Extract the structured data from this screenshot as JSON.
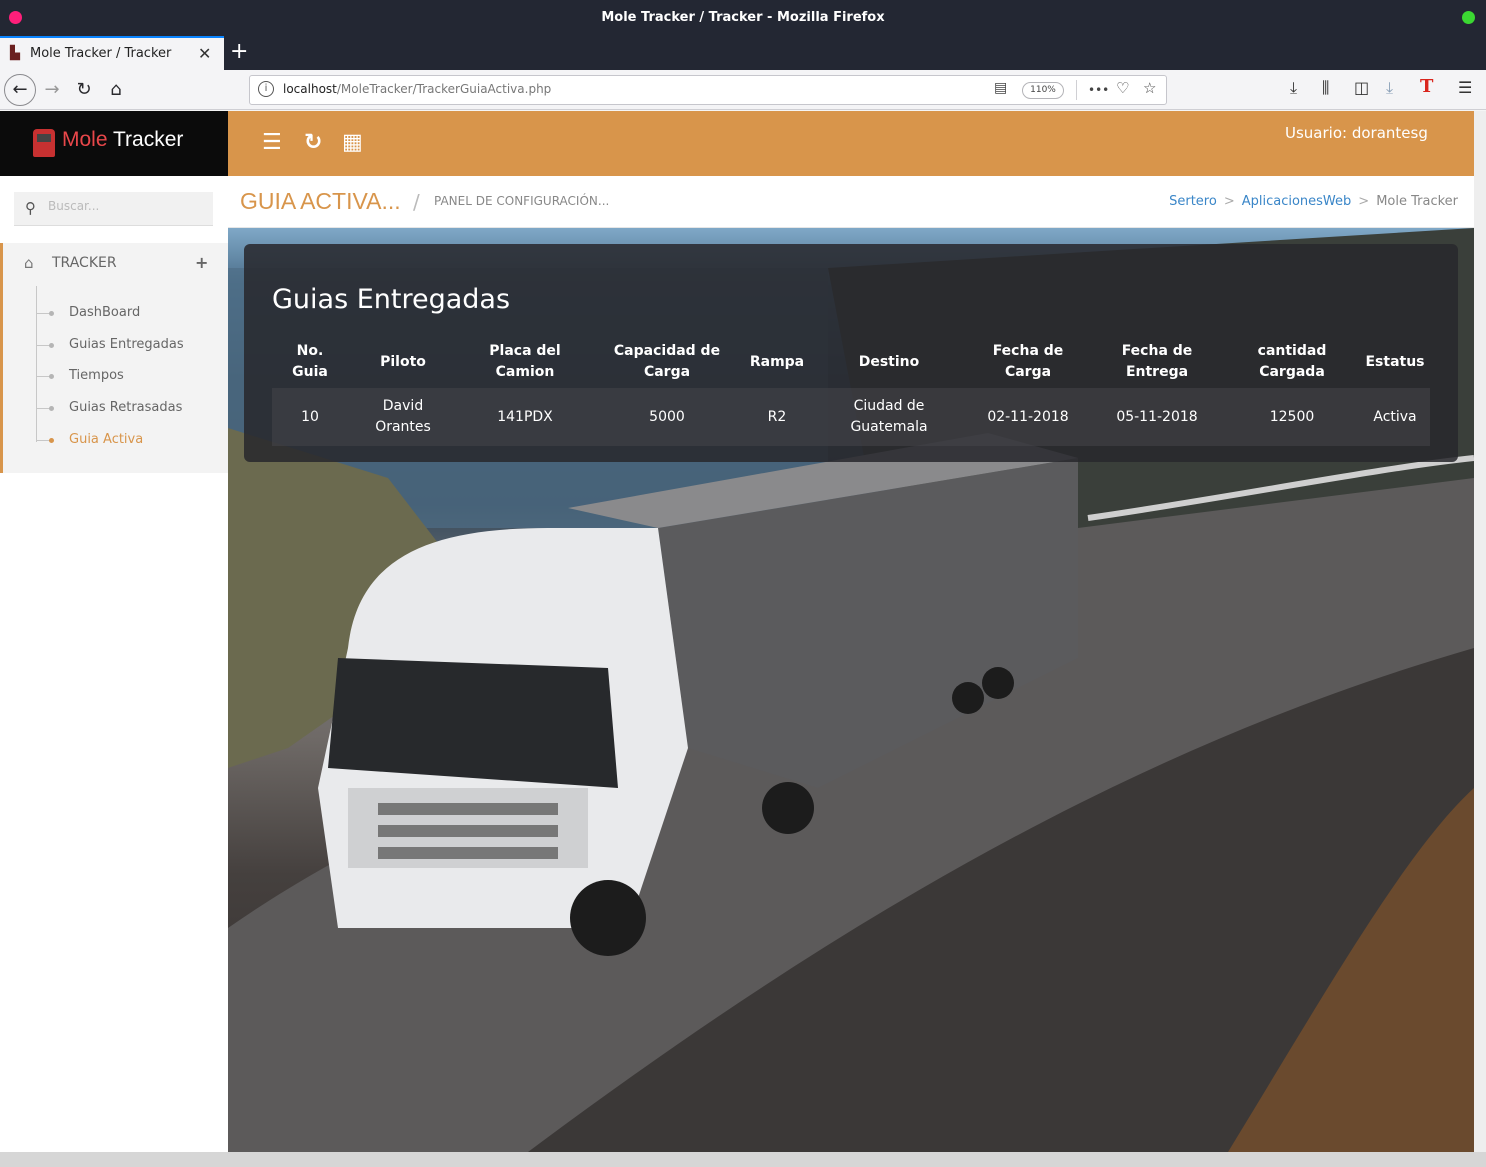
{
  "window": {
    "title": "Mole Tracker / Tracker - Mozilla Firefox"
  },
  "tab": {
    "label": "Mole Tracker / Tracker",
    "close": "✕",
    "new": "+"
  },
  "nav": {
    "url_host": "localhost",
    "url_path": "/MoleTracker/TrackerGuiaActiva.php",
    "zoom": "110%",
    "more": "•••"
  },
  "brand": {
    "mole": "Mole",
    "tracker": " Tracker"
  },
  "header": {
    "user": "Usuario: dorantesg"
  },
  "sidebar": {
    "search_placeholder": "Buscar...",
    "section": "TRACKER",
    "items": [
      {
        "label": "DashBoard",
        "active": false
      },
      {
        "label": "Guias Entregadas",
        "active": false
      },
      {
        "label": "Tiempos",
        "active": false
      },
      {
        "label": "Guias Retrasadas",
        "active": false
      },
      {
        "label": "Guia Activa",
        "active": true
      }
    ]
  },
  "breadcrumb": {
    "title": "GUIA ACTIVA...",
    "subtitle": "PANEL DE CONFIGURACIÓN...",
    "links": [
      "Sertero",
      "AplicacionesWeb"
    ],
    "current": "Mole Tracker"
  },
  "panel": {
    "heading": "Guias Entregadas",
    "columns": [
      [
        "No.",
        "Guia"
      ],
      [
        "Piloto"
      ],
      [
        "Placa del",
        "Camion"
      ],
      [
        "Capacidad de",
        "Carga"
      ],
      [
        "Rampa"
      ],
      [
        "Destino"
      ],
      [
        "Fecha de",
        "Carga"
      ],
      [
        "Fecha de",
        "Entrega"
      ],
      [
        "cantidad",
        "Cargada"
      ],
      [
        "Estatus"
      ]
    ],
    "rows": [
      [
        [
          "10"
        ],
        [
          "David",
          "Orantes"
        ],
        [
          "141PDX"
        ],
        [
          "5000"
        ],
        [
          "R2"
        ],
        [
          "Ciudad de",
          "Guatemala"
        ],
        [
          "02-11-2018"
        ],
        [
          "05-11-2018"
        ],
        [
          "12500"
        ],
        [
          "Activa"
        ]
      ]
    ]
  },
  "colors": {
    "accent": "#d8954b",
    "brand_red": "#e8474a",
    "link": "#3a86c8"
  },
  "icons": {
    "back": "←",
    "forward": "→",
    "reload": "↻",
    "home": "⌂",
    "menu": "☰",
    "refresh": "↻",
    "grid": "▦",
    "search": "⚲",
    "home_menu": "⌂",
    "plus": "+",
    "reader": "▤",
    "pocket": "♡",
    "star": "☆",
    "download": "⤓",
    "library": "⫼",
    "sidebar": "◫",
    "hamburger": "☰",
    "ext": "T"
  }
}
